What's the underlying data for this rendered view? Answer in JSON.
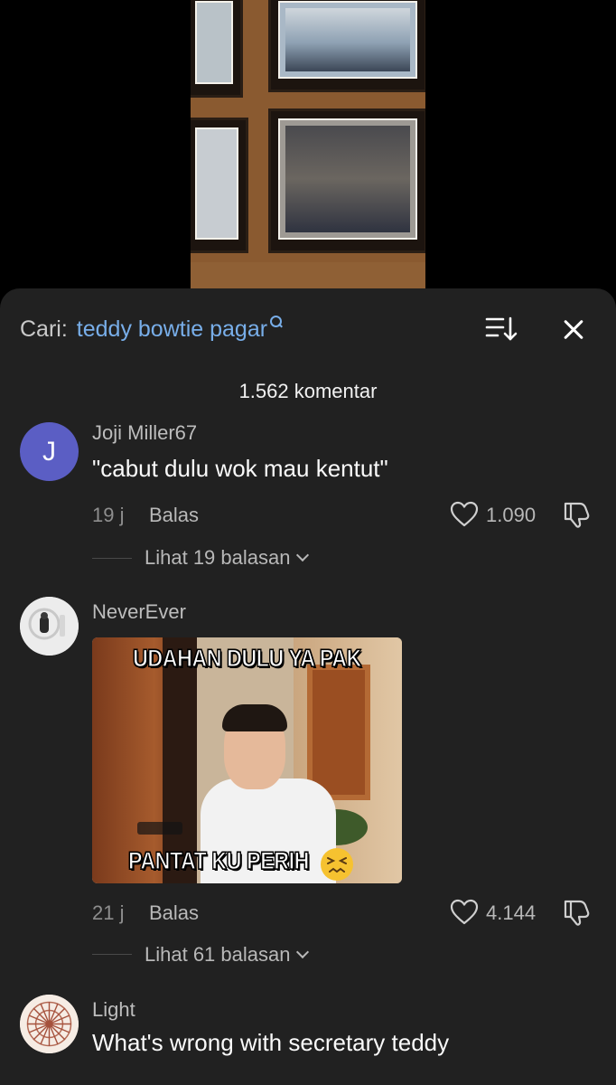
{
  "search": {
    "prefix": "Cari:",
    "query": "teddy bowtie pagar"
  },
  "comments_header": {
    "count_label": "1.562 komentar"
  },
  "comments": [
    {
      "username": "Joji Miller67",
      "avatar_initial": "J",
      "text": "\"cabut dulu wok mau kentut\"",
      "time": "19 j",
      "reply_label": "Balas",
      "likes": "1.090",
      "replies_label": "Lihat 19 balasan"
    },
    {
      "username": "NeverEver",
      "image_caption_top": "UDAHAN DULU YA PAK",
      "image_caption_bottom": "PANTAT KU PERIH",
      "time": "21 j",
      "reply_label": "Balas",
      "likes": "4.144",
      "replies_label": "Lihat 61 balasan"
    },
    {
      "username": "Light",
      "text": "What's wrong with secretary teddy",
      "time": "",
      "reply_label": "",
      "likes": ""
    }
  ],
  "colors": {
    "sheet_bg": "#212121",
    "search_accent": "#78aee9",
    "avatar_j": "#5b5ec4"
  }
}
